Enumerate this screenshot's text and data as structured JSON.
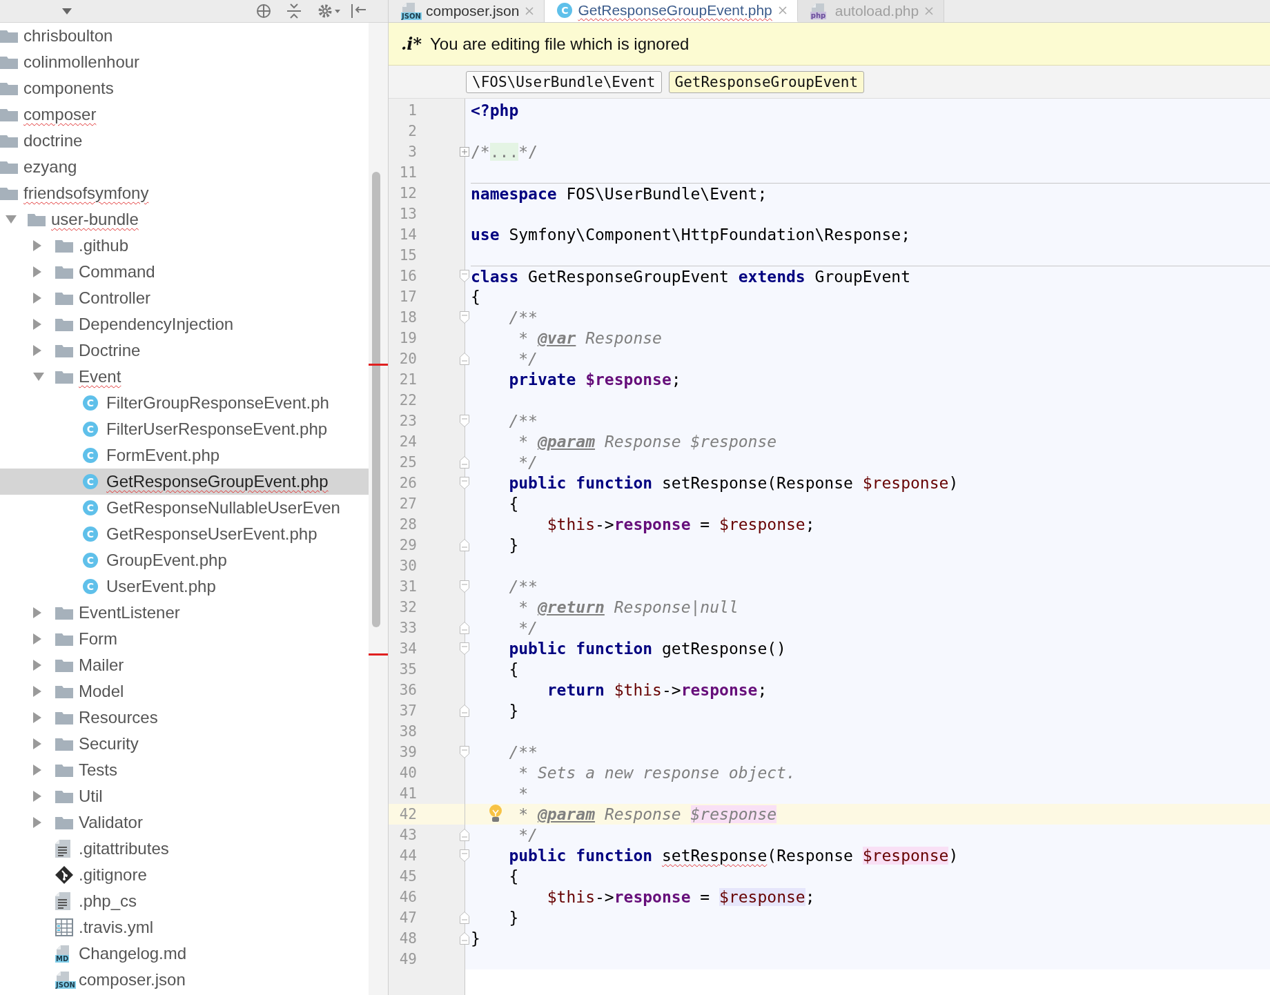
{
  "tabs": [
    {
      "label": "composer.json",
      "kind": "json",
      "badge": "JSON",
      "selected": false,
      "dimmed": false,
      "error": false
    },
    {
      "label": "GetResponseGroupEvent.php",
      "kind": "class",
      "badge": "C",
      "selected": true,
      "dimmed": false,
      "error": true
    },
    {
      "label": "autoload.php",
      "kind": "php",
      "badge": "php",
      "selected": false,
      "dimmed": true,
      "error": false
    }
  ],
  "banner": {
    "marker": ".i*",
    "message": "You are editing file which is ignored"
  },
  "breadcrumbs": [
    {
      "label": "\\FOS\\UserBundle\\Event",
      "selected": false
    },
    {
      "label": "GetResponseGroupEvent",
      "selected": true
    }
  ],
  "tree": [
    {
      "label": "chrisboulton",
      "kind": "folder",
      "selected": false,
      "error": false
    },
    {
      "label": "colinmollenhour",
      "kind": "folder",
      "selected": false,
      "error": false
    },
    {
      "label": "components",
      "kind": "folder",
      "selected": false,
      "error": false
    },
    {
      "label": "composer",
      "kind": "folder",
      "selected": false,
      "error": true
    },
    {
      "label": "doctrine",
      "kind": "folder",
      "selected": false,
      "error": false
    },
    {
      "label": "ezyang",
      "kind": "folder",
      "selected": false,
      "error": false
    },
    {
      "label": "friendsofsymfony",
      "kind": "folder",
      "selected": false,
      "error": true,
      "children": [
        {
          "label": "user-bundle",
          "kind": "folder",
          "selected": false,
          "error": true,
          "expanded": true,
          "children": [
            {
              "label": ".github",
              "kind": "folder",
              "selected": false,
              "error": false,
              "expanded": false
            },
            {
              "label": "Command",
              "kind": "folder",
              "selected": false,
              "error": false,
              "expanded": false
            },
            {
              "label": "Controller",
              "kind": "folder",
              "selected": false,
              "error": false,
              "expanded": false
            },
            {
              "label": "DependencyInjection",
              "kind": "folder",
              "selected": false,
              "error": false,
              "expanded": false
            },
            {
              "label": "Doctrine",
              "kind": "folder",
              "selected": false,
              "error": false,
              "expanded": false
            },
            {
              "label": "Event",
              "kind": "folder",
              "selected": false,
              "error": true,
              "expanded": true,
              "children": [
                {
                  "label": "FilterGroupResponseEvent.ph",
                  "kind": "class",
                  "badge": "C",
                  "selected": false,
                  "error": false
                },
                {
                  "label": "FilterUserResponseEvent.php",
                  "kind": "class",
                  "badge": "C",
                  "selected": false,
                  "error": false
                },
                {
                  "label": "FormEvent.php",
                  "kind": "class",
                  "badge": "C",
                  "selected": false,
                  "error": false
                },
                {
                  "label": "GetResponseGroupEvent.php",
                  "kind": "class",
                  "badge": "C",
                  "selected": true,
                  "error": true
                },
                {
                  "label": "GetResponseNullableUserEven",
                  "kind": "class",
                  "badge": "C",
                  "selected": false,
                  "error": false
                },
                {
                  "label": "GetResponseUserEvent.php",
                  "kind": "class",
                  "badge": "C",
                  "selected": false,
                  "error": false
                },
                {
                  "label": "GroupEvent.php",
                  "kind": "class",
                  "badge": "C",
                  "selected": false,
                  "error": false
                },
                {
                  "label": "UserEvent.php",
                  "kind": "class",
                  "badge": "C",
                  "selected": false,
                  "error": false
                }
              ]
            },
            {
              "label": "EventListener",
              "kind": "folder",
              "selected": false,
              "error": false,
              "expanded": false
            },
            {
              "label": "Form",
              "kind": "folder",
              "selected": false,
              "error": false,
              "expanded": false
            },
            {
              "label": "Mailer",
              "kind": "folder",
              "selected": false,
              "error": false,
              "expanded": false
            },
            {
              "label": "Model",
              "kind": "folder",
              "selected": false,
              "error": false,
              "expanded": false
            },
            {
              "label": "Resources",
              "kind": "folder",
              "selected": false,
              "error": false,
              "expanded": false
            },
            {
              "label": "Security",
              "kind": "folder",
              "selected": false,
              "error": false,
              "expanded": false
            },
            {
              "label": "Tests",
              "kind": "folder",
              "selected": false,
              "error": false,
              "expanded": false
            },
            {
              "label": "Util",
              "kind": "folder",
              "selected": false,
              "error": false,
              "expanded": false
            },
            {
              "label": "Validator",
              "kind": "folder",
              "selected": false,
              "error": false,
              "expanded": false
            },
            {
              "label": ".gitattributes",
              "kind": "text",
              "selected": false,
              "error": false
            },
            {
              "label": ".gitignore",
              "kind": "git",
              "selected": false,
              "error": false
            },
            {
              "label": ".php_cs",
              "kind": "text",
              "selected": false,
              "error": false
            },
            {
              "label": ".travis.yml",
              "kind": "table",
              "selected": false,
              "error": false
            },
            {
              "label": "Changelog.md",
              "kind": "md",
              "badge": "MD",
              "selected": false,
              "error": false
            },
            {
              "label": "composer.json",
              "kind": "json",
              "badge": "JSON",
              "selected": false,
              "error": false
            }
          ]
        }
      ]
    }
  ],
  "code": [
    {
      "n": "1",
      "tokens": [
        {
          "text": "<?php",
          "kind": "kw"
        }
      ]
    },
    {
      "n": "2"
    },
    {
      "n": "3",
      "fold_marker": {
        "kind": "plus"
      },
      "tokens": [
        {
          "text": "/*",
          "kind": "comment"
        },
        {
          "text": "...",
          "kind": "folded"
        },
        {
          "text": "*/",
          "kind": "comment"
        }
      ]
    },
    {
      "n": "11"
    },
    {
      "n": "12",
      "separator": true,
      "tokens": [
        {
          "text": "namespace",
          "kind": "kw"
        },
        {
          "text": " FOS\\UserBundle\\Event;",
          "kind": "plain"
        }
      ]
    },
    {
      "n": "13"
    },
    {
      "n": "14",
      "tokens": [
        {
          "text": "use",
          "kind": "kw"
        },
        {
          "text": " Symfony\\Component\\HttpFoundation\\Response;",
          "kind": "plain"
        }
      ]
    },
    {
      "n": "15"
    },
    {
      "n": "16",
      "separator": true,
      "fold_marker": {
        "kind": "open"
      },
      "tokens": [
        {
          "text": "class",
          "kind": "kw"
        },
        {
          "text": " GetResponseGroupEvent ",
          "kind": "plain"
        },
        {
          "text": "extends",
          "kind": "kw"
        },
        {
          "text": " GroupEvent",
          "kind": "plain"
        }
      ]
    },
    {
      "n": "17",
      "tokens": [
        {
          "text": "{",
          "kind": "plain"
        }
      ]
    },
    {
      "n": "18",
      "fold_marker": {
        "kind": "open"
      },
      "tokens": [
        {
          "text": "    /**",
          "kind": "doc"
        }
      ]
    },
    {
      "n": "19",
      "tokens": [
        {
          "text": "     * ",
          "kind": "doc"
        },
        {
          "text": "@var",
          "kind": "doctag"
        },
        {
          "text": " Response",
          "kind": "doc"
        }
      ]
    },
    {
      "n": "20",
      "fold_marker": {
        "kind": "close"
      },
      "tokens": [
        {
          "text": "     */",
          "kind": "doc"
        }
      ]
    },
    {
      "n": "21",
      "tokens": [
        {
          "text": "    private ",
          "kind": "kw"
        },
        {
          "text": "$response",
          "kind": "field"
        },
        {
          "text": ";",
          "kind": "plain"
        }
      ]
    },
    {
      "n": "22"
    },
    {
      "n": "23",
      "fold_marker": {
        "kind": "open"
      },
      "tokens": [
        {
          "text": "    /**",
          "kind": "doc"
        }
      ]
    },
    {
      "n": "24",
      "tokens": [
        {
          "text": "     * ",
          "kind": "doc"
        },
        {
          "text": "@param",
          "kind": "doctag"
        },
        {
          "text": " Response $response",
          "kind": "doc"
        }
      ]
    },
    {
      "n": "25",
      "fold_marker": {
        "kind": "close"
      },
      "tokens": [
        {
          "text": "     */",
          "kind": "doc"
        }
      ]
    },
    {
      "n": "26",
      "fold_marker": {
        "kind": "open"
      },
      "tokens": [
        {
          "text": "    public function ",
          "kind": "kw"
        },
        {
          "text": "setResponse(Response ",
          "kind": "plain"
        },
        {
          "text": "$response",
          "kind": "var"
        },
        {
          "text": ")",
          "kind": "plain"
        }
      ]
    },
    {
      "n": "27",
      "tokens": [
        {
          "text": "    {",
          "kind": "plain"
        }
      ]
    },
    {
      "n": "28",
      "tokens": [
        {
          "text": "        $this",
          "kind": "var"
        },
        {
          "text": "->",
          "kind": "plain"
        },
        {
          "text": "response",
          "kind": "field"
        },
        {
          "text": " = ",
          "kind": "plain"
        },
        {
          "text": "$response",
          "kind": "var"
        },
        {
          "text": ";",
          "kind": "plain"
        }
      ]
    },
    {
      "n": "29",
      "fold_marker": {
        "kind": "close"
      },
      "tokens": [
        {
          "text": "    }",
          "kind": "plain"
        }
      ]
    },
    {
      "n": "30"
    },
    {
      "n": "31",
      "fold_marker": {
        "kind": "open"
      },
      "tokens": [
        {
          "text": "    /**",
          "kind": "doc"
        }
      ]
    },
    {
      "n": "32",
      "tokens": [
        {
          "text": "     * ",
          "kind": "doc"
        },
        {
          "text": "@return",
          "kind": "doctag"
        },
        {
          "text": " Response|null",
          "kind": "doc"
        }
      ]
    },
    {
      "n": "33",
      "fold_marker": {
        "kind": "close"
      },
      "tokens": [
        {
          "text": "     */",
          "kind": "doc"
        }
      ]
    },
    {
      "n": "34",
      "fold_marker": {
        "kind": "open"
      },
      "tokens": [
        {
          "text": "    public function ",
          "kind": "kw"
        },
        {
          "text": "getResponse()",
          "kind": "plain"
        }
      ]
    },
    {
      "n": "35",
      "tokens": [
        {
          "text": "    {",
          "kind": "plain"
        }
      ]
    },
    {
      "n": "36",
      "tokens": [
        {
          "text": "        return ",
          "kind": "kw"
        },
        {
          "text": "$this",
          "kind": "var"
        },
        {
          "text": "->",
          "kind": "plain"
        },
        {
          "text": "response",
          "kind": "field"
        },
        {
          "text": ";",
          "kind": "plain"
        }
      ]
    },
    {
      "n": "37",
      "fold_marker": {
        "kind": "close"
      },
      "tokens": [
        {
          "text": "    }",
          "kind": "plain"
        }
      ]
    },
    {
      "n": "38"
    },
    {
      "n": "39",
      "fold_marker": {
        "kind": "open"
      },
      "tokens": [
        {
          "text": "    /**",
          "kind": "doc"
        }
      ]
    },
    {
      "n": "40",
      "tokens": [
        {
          "text": "     * Sets a new response object.",
          "kind": "doc"
        }
      ]
    },
    {
      "n": "41",
      "tokens": [
        {
          "text": "     *",
          "kind": "doc"
        }
      ]
    },
    {
      "n": "42",
      "current": true,
      "bulb": true,
      "tokens": [
        {
          "text": "     * ",
          "kind": "doc"
        },
        {
          "text": "@param",
          "kind": "doctag"
        },
        {
          "text": " Response ",
          "kind": "doc"
        },
        {
          "text": "$response",
          "kind": "doc",
          "highlight": {
            "kind": "write"
          }
        }
      ]
    },
    {
      "n": "43",
      "fold_marker": {
        "kind": "close"
      },
      "tokens": [
        {
          "text": "     */",
          "kind": "doc"
        }
      ]
    },
    {
      "n": "44",
      "fold_marker": {
        "kind": "open"
      },
      "tokens": [
        {
          "text": "    public function ",
          "kind": "kw"
        },
        {
          "text": "setResponse",
          "kind": "plain",
          "error": true
        },
        {
          "text": "(Response ",
          "kind": "plain"
        },
        {
          "text": "$response",
          "kind": "var",
          "highlight": {
            "kind": "write"
          }
        },
        {
          "text": ")",
          "kind": "plain"
        }
      ]
    },
    {
      "n": "45",
      "tokens": [
        {
          "text": "    {",
          "kind": "plain"
        }
      ]
    },
    {
      "n": "46",
      "tokens": [
        {
          "text": "        $this",
          "kind": "var"
        },
        {
          "text": "->",
          "kind": "plain"
        },
        {
          "text": "response",
          "kind": "field"
        },
        {
          "text": " = ",
          "kind": "plain"
        },
        {
          "text": "$response",
          "kind": "var",
          "highlight": {
            "kind": "read"
          }
        },
        {
          "text": ";",
          "kind": "plain"
        }
      ]
    },
    {
      "n": "47",
      "fold_marker": {
        "kind": "close"
      },
      "tokens": [
        {
          "text": "    }",
          "kind": "plain"
        }
      ]
    },
    {
      "n": "48",
      "fold_marker": {
        "kind": "close"
      },
      "tokens": [
        {
          "text": "}",
          "kind": "plain"
        }
      ]
    },
    {
      "n": "49"
    }
  ]
}
